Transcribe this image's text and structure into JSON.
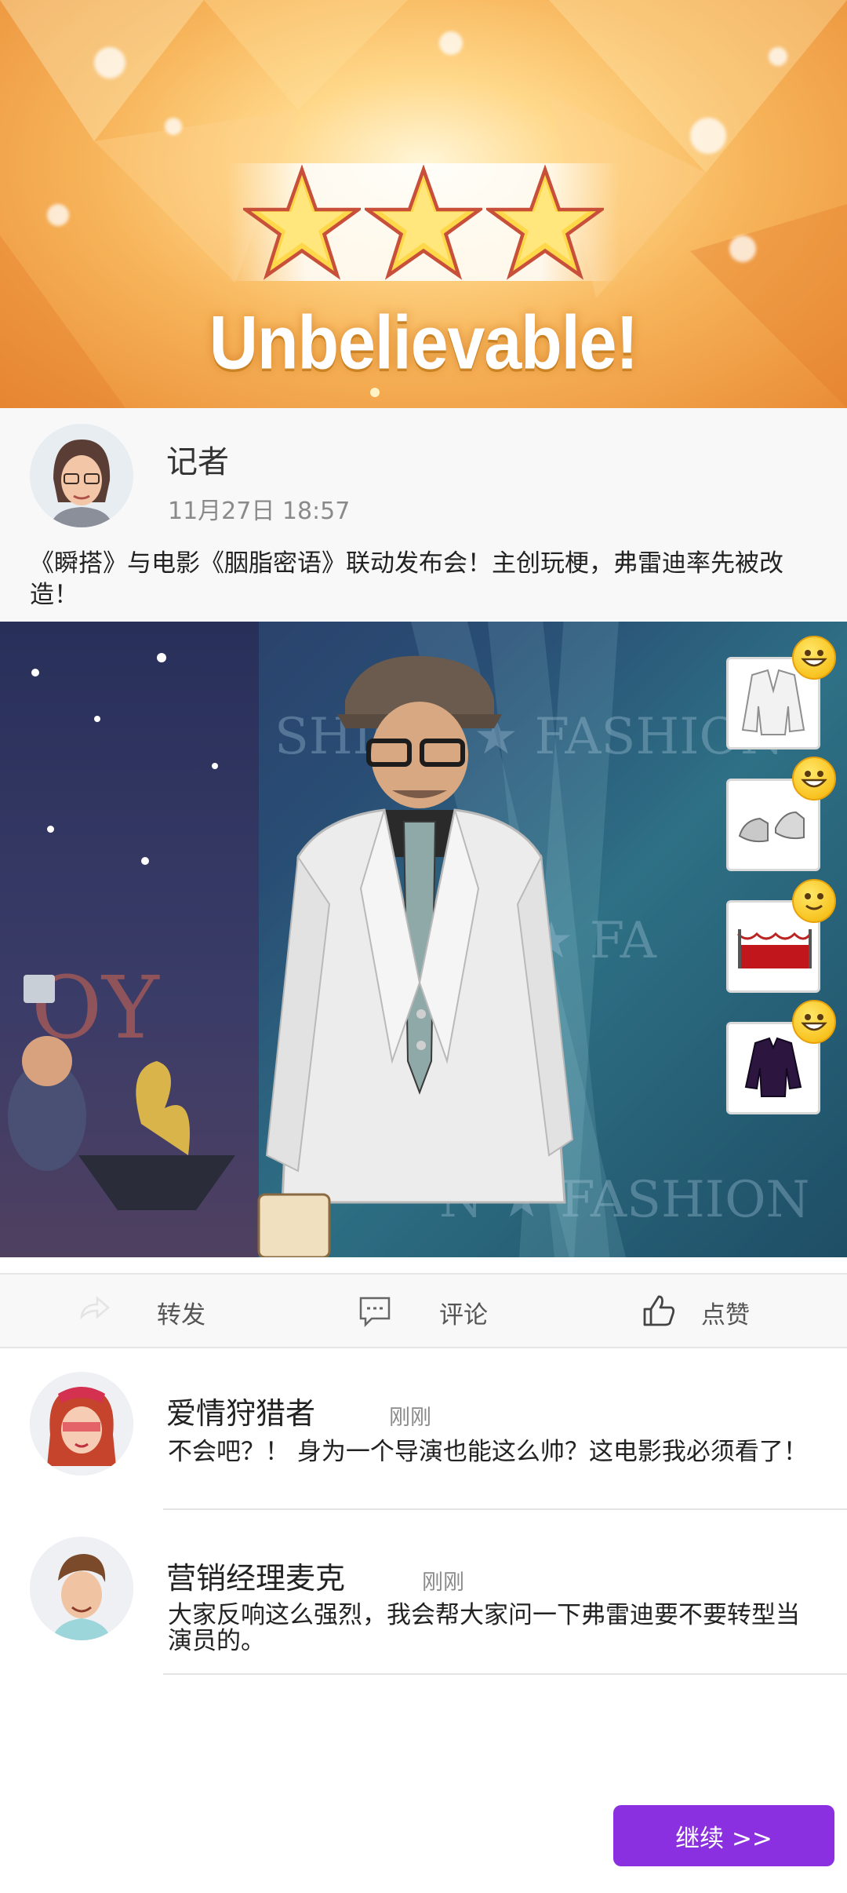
{
  "banner": {
    "rating_stars": 3,
    "title": "Unbelievable!"
  },
  "post": {
    "author": "记者",
    "time": "11月27日 18:57",
    "text": "《瞬搭》与电影《胭脂密语》联动发布会！主创玩梗，弗雷迪率先被改造！"
  },
  "outfit_items": [
    {
      "name": "white-blazer",
      "reaction": "grin-emoji"
    },
    {
      "name": "silver-shoes",
      "reaction": "grin-emoji"
    },
    {
      "name": "red-carpet-stage",
      "reaction": "smile-emoji"
    },
    {
      "name": "dark-purple-shirt",
      "reaction": "grin-emoji"
    }
  ],
  "actions": {
    "share": "转发",
    "comment": "评论",
    "like": "点赞"
  },
  "comments": [
    {
      "author": "爱情狩猎者",
      "time": "刚刚",
      "text": "不会吧？！ 身为一个导演也能这么帅？这电影我必须看了！"
    },
    {
      "author": "营销经理麦克",
      "time": "刚刚",
      "text": "大家反响这么强烈，我会帮大家问一下弗雷迪要不要转型当演员的。"
    }
  ],
  "continue_label": "继续 >>",
  "colors": {
    "accent": "#8a30e0",
    "banner": "#f7b45a"
  }
}
